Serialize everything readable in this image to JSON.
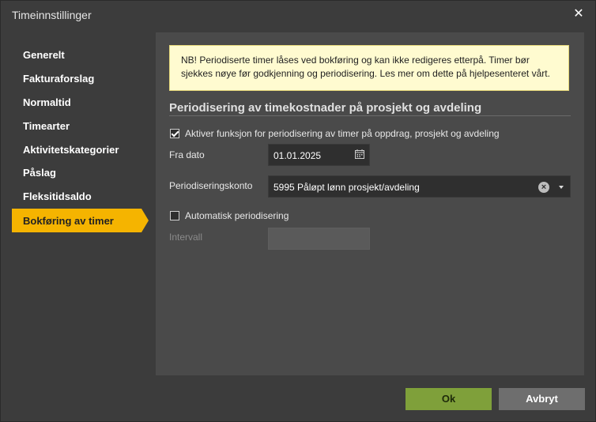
{
  "dialog": {
    "title": "Timeinnstillinger",
    "close_symbol": "✕"
  },
  "sidebar": {
    "items": [
      {
        "label": "Generelt"
      },
      {
        "label": "Fakturaforslag"
      },
      {
        "label": "Normaltid"
      },
      {
        "label": "Timearter"
      },
      {
        "label": "Aktivitetskategorier"
      },
      {
        "label": "Påslag"
      },
      {
        "label": "Fleksitidsaldo"
      },
      {
        "label": "Bokføring av timer",
        "active": true
      }
    ]
  },
  "notice": {
    "text": "NB! Periodiserte timer låses ved bokføring og kan ikke redigeres etterpå. Timer bør sjekkes nøye før godkjenning og periodisering. Les mer om dette på hjelpesenteret vårt."
  },
  "section": {
    "title": "Periodisering av timekostnader på prosjekt og avdeling",
    "enable_checkbox": {
      "label": "Aktiver funksjon for periodisering av timer på oppdrag, prosjekt og avdeling",
      "checked": true
    },
    "from_date": {
      "label": "Fra dato",
      "value": "01.01.2025"
    },
    "account": {
      "label": "Periodiseringskonto",
      "value": "5995 Påløpt lønn prosjekt/avdeling"
    },
    "auto_checkbox": {
      "label": "Automatisk periodisering",
      "checked": false
    },
    "interval": {
      "label": "Intervall",
      "value": ""
    }
  },
  "footer": {
    "ok_label": "Ok",
    "cancel_label": "Avbryt"
  },
  "colors": {
    "accent": "#f5b400",
    "ok_button": "#7fa03a",
    "notice_bg": "#fffbd0"
  }
}
